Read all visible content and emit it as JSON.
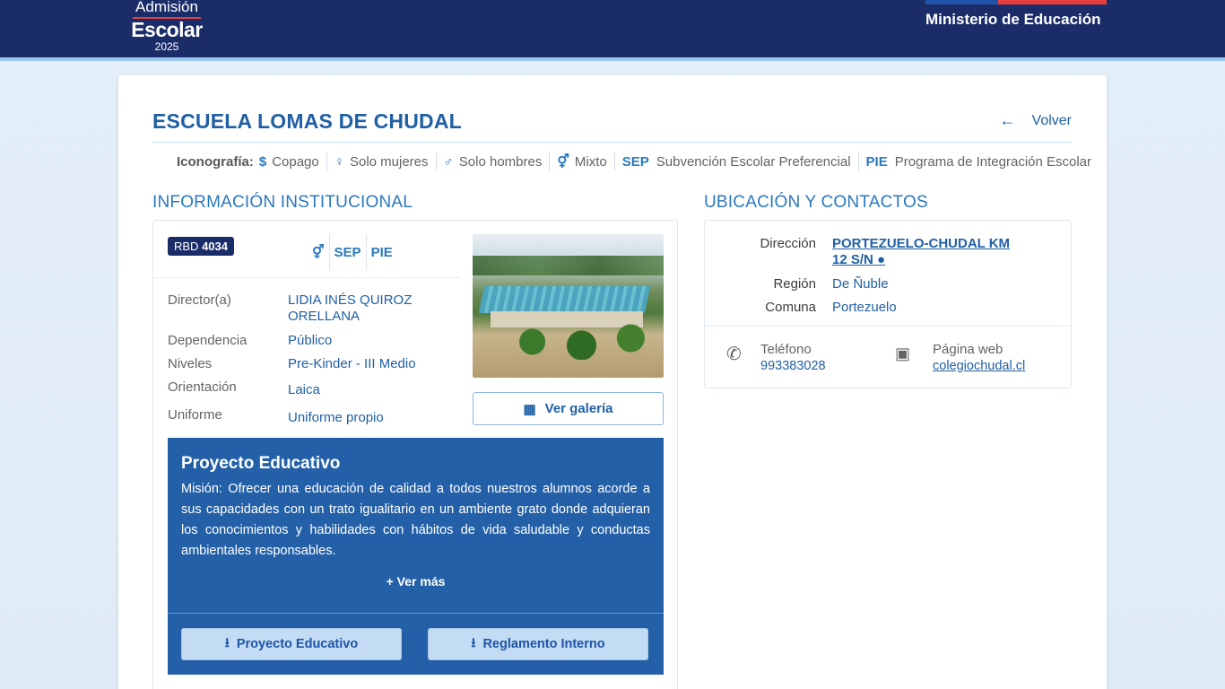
{
  "header": {
    "logo": {
      "line1": "Admisión",
      "line2": "Escolar",
      "year": "2025"
    },
    "ministry": "Ministerio de Educación",
    "colors": {
      "navy": "#1b2d69",
      "flag_blue": "#1f54a8",
      "flag_red": "#e63d3d"
    }
  },
  "school": {
    "name": "ESCUELA LOMAS DE CHUDAL",
    "back_label": "Volver"
  },
  "iconography": {
    "label": "Iconografía:",
    "items": [
      {
        "icon": "dollar-icon",
        "glyph": "$",
        "text": "Copago"
      },
      {
        "icon": "female-icon",
        "glyph": "♀",
        "text": "Solo mujeres"
      },
      {
        "icon": "male-icon",
        "glyph": "♂",
        "text": "Solo hombres"
      },
      {
        "icon": "mixed-icon",
        "glyph": "⚥",
        "text": "Mixto"
      },
      {
        "tag": "SEP",
        "text": "Subvención Escolar Preferencial"
      },
      {
        "tag": "PIE",
        "text": "Programa de Integración Escolar"
      }
    ]
  },
  "institutional": {
    "heading": "INFORMACIÓN INSTITUCIONAL",
    "rbd_label": "RBD",
    "rbd_value": "4034",
    "badges": {
      "sep": "SEP",
      "pie": "PIE"
    },
    "rows": [
      {
        "key": "Director(a)",
        "value": "LIDIA INÉS QUIROZ ORELLANA"
      },
      {
        "key": "Dependencia",
        "value": "Público"
      },
      {
        "key": "Niveles",
        "value": "Pre-Kinder - III Medio"
      },
      {
        "key": "Orientación",
        "value": "Laica"
      },
      {
        "key": "Uniforme",
        "value": "Uniforme propio"
      }
    ],
    "gallery_label": "Ver galería"
  },
  "project": {
    "title": "Proyecto Educativo",
    "text": "Misión: Ofrecer una educación de calidad a todos nuestros alumnos acorde a sus capacidades con un trato igualitario en un ambiente grato donde adquieran los conocimientos y habilidades con hábitos de vida saludable y conductas ambientales responsables.",
    "more": "+ Ver más",
    "downloads": [
      "Proyecto Educativo",
      "Reglamento Interno"
    ]
  },
  "location": {
    "heading": "UBICACIÓN Y CONTACTOS",
    "address_label": "Dirección",
    "address_value": "PORTEZUELO-CHUDAL KM 12 S/N",
    "region_label": "Región",
    "region_value": "De Ñuble",
    "commune_label": "Comuna",
    "commune_value": "Portezuelo",
    "phone_label": "Teléfono",
    "phone_value": "993383028",
    "web_label": "Página web",
    "web_value": "colegiochudal.cl"
  }
}
